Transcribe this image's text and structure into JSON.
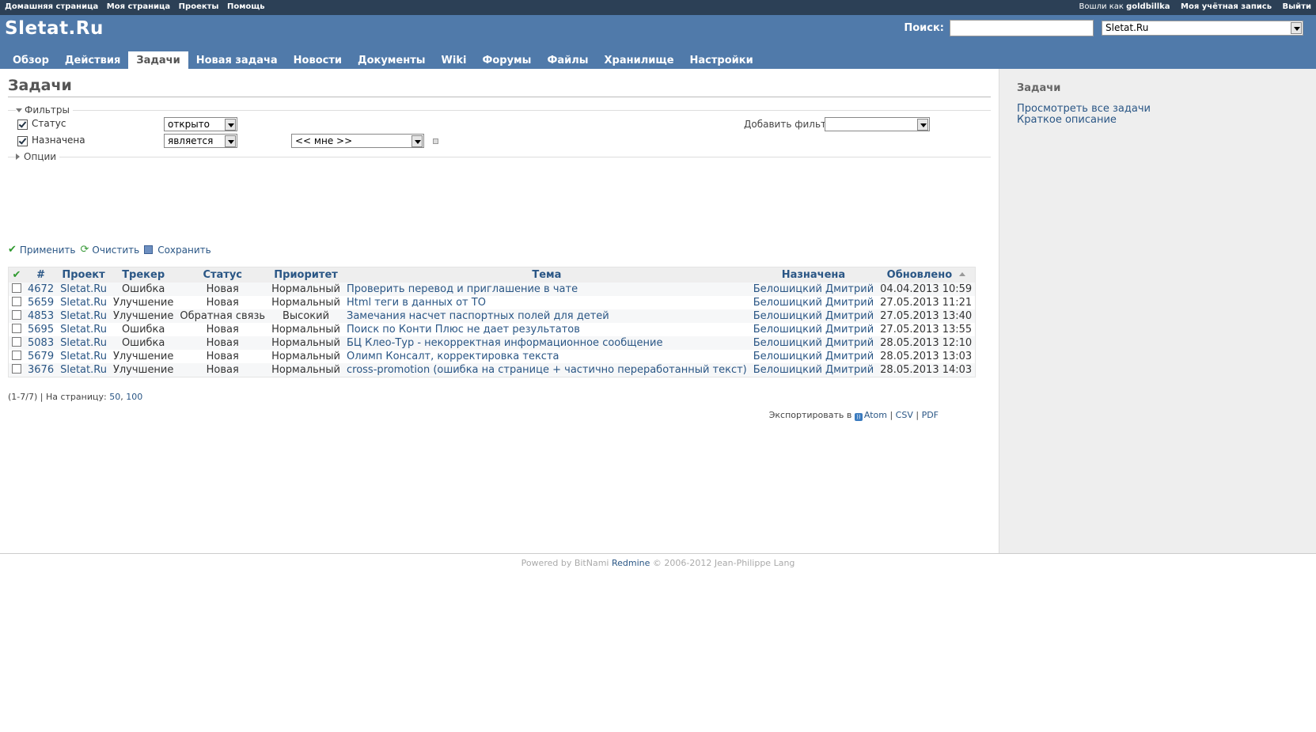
{
  "top_menu": {
    "left": [
      "Домашняя страница",
      "Моя страница",
      "Проекты",
      "Помощь"
    ],
    "logged_in_prefix": "Вошли как",
    "username": "goldbillka",
    "my_account": "Моя учётная запись",
    "logout": "Выйти"
  },
  "header": {
    "title": "Sletat.Ru",
    "search_label": "Поиск:",
    "search_value": "",
    "project_select": "Sletat.Ru"
  },
  "tabs": [
    {
      "label": "Обзор",
      "selected": false
    },
    {
      "label": "Действия",
      "selected": false
    },
    {
      "label": "Задачи",
      "selected": true
    },
    {
      "label": "Новая задача",
      "selected": false
    },
    {
      "label": "Новости",
      "selected": false
    },
    {
      "label": "Документы",
      "selected": false
    },
    {
      "label": "Wiki",
      "selected": false
    },
    {
      "label": "Форумы",
      "selected": false
    },
    {
      "label": "Файлы",
      "selected": false
    },
    {
      "label": "Хранилище",
      "selected": false
    },
    {
      "label": "Настройки",
      "selected": false
    }
  ],
  "content": {
    "title": "Задачи",
    "filters_legend": "Фильтры",
    "filter_status_label": "Статус",
    "filter_status_op": "открыто",
    "filter_assigned_label": "Назначена",
    "filter_assigned_op": "является",
    "filter_assigned_value": "<< мне >>",
    "add_filter_label": "Добавить фильтр",
    "add_filter_value": "",
    "options_legend": "Опции",
    "apply": "Применить",
    "clear": "Очистить",
    "save": "Сохранить"
  },
  "table": {
    "headers": [
      "#",
      "Проект",
      "Трекер",
      "Статус",
      "Приоритет",
      "Тема",
      "Назначена",
      "Обновлено"
    ],
    "rows": [
      {
        "id": "4672",
        "project": "Sletat.Ru",
        "tracker": "Ошибка",
        "status": "Новая",
        "priority": "Нормальный",
        "subject": "Проверить перевод и приглашение в чате",
        "assigned": "Белошицкий Дмитрий",
        "updated": "04.04.2013 10:59"
      },
      {
        "id": "5659",
        "project": "Sletat.Ru",
        "tracker": "Улучшение",
        "status": "Новая",
        "priority": "Нормальный",
        "subject": "Html теги в данных от ТО",
        "assigned": "Белошицкий Дмитрий",
        "updated": "27.05.2013 11:21"
      },
      {
        "id": "4853",
        "project": "Sletat.Ru",
        "tracker": "Улучшение",
        "status": "Обратная связь",
        "priority": "Высокий",
        "subject": "Замечания насчет паспортных полей для детей",
        "assigned": "Белошицкий Дмитрий",
        "updated": "27.05.2013 13:40"
      },
      {
        "id": "5695",
        "project": "Sletat.Ru",
        "tracker": "Ошибка",
        "status": "Новая",
        "priority": "Нормальный",
        "subject": "Поиск по Конти Плюс не дает результатов",
        "assigned": "Белошицкий Дмитрий",
        "updated": "27.05.2013 13:55"
      },
      {
        "id": "5083",
        "project": "Sletat.Ru",
        "tracker": "Ошибка",
        "status": "Новая",
        "priority": "Нормальный",
        "subject": "БЦ Клео-Тур - некорректная информационное сообщение",
        "assigned": "Белошицкий Дмитрий",
        "updated": "28.05.2013 12:10"
      },
      {
        "id": "5679",
        "project": "Sletat.Ru",
        "tracker": "Улучшение",
        "status": "Новая",
        "priority": "Нормальный",
        "subject": "Олимп Консалт, корректировка текста",
        "assigned": "Белошицкий Дмитрий",
        "updated": "28.05.2013 13:03"
      },
      {
        "id": "3676",
        "project": "Sletat.Ru",
        "tracker": "Улучшение",
        "status": "Новая",
        "priority": "Нормальный",
        "subject": "cross-promotion (ошибка на странице + частично переработанный текст)",
        "assigned": "Белошицкий Дмитрий",
        "updated": "28.05.2013 14:03"
      }
    ]
  },
  "pagination": {
    "range": "(1-7/7)",
    "per_page_label": "На страницу:",
    "per_page_options": [
      "50",
      "100"
    ]
  },
  "export": {
    "label": "Экспортировать в",
    "formats": [
      "Atom",
      "CSV",
      "PDF"
    ]
  },
  "sidebar": {
    "title": "Задачи",
    "links": [
      "Просмотреть все задачи",
      "Краткое описание"
    ]
  },
  "footer": {
    "prefix": "Powered by BitNami",
    "link": "Redmine",
    "suffix": "© 2006-2012 Jean-Philippe Lang"
  },
  "colors": {
    "top_menu_bg": "#2C4056",
    "header_bg": "#507AAA",
    "link": "#2A5685",
    "sidebar_bg": "#EEEEEE"
  }
}
